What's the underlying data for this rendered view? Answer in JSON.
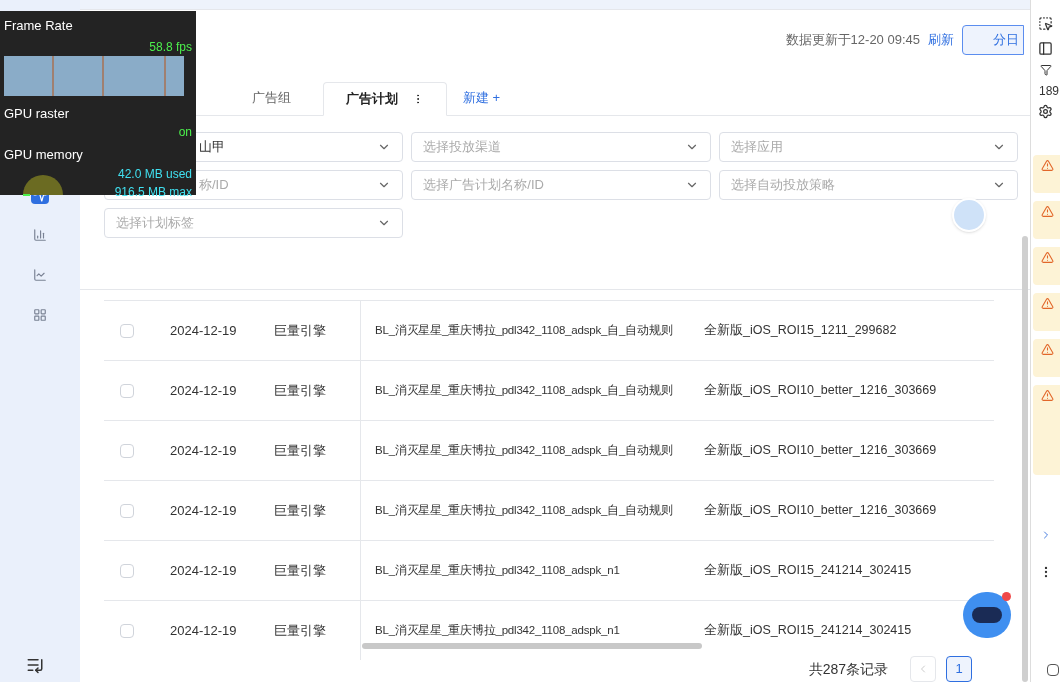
{
  "overlay": {
    "frame_rate_label": "Frame Rate",
    "fps": "58.8 fps",
    "gpu_raster_label": "GPU raster",
    "gpu_raster_value": "on",
    "gpu_memory_label": "GPU memory",
    "memory_used": "42.0 MB used",
    "memory_max": "916.5 MB max"
  },
  "sidebar": {
    "items": [
      {
        "selected": true
      },
      {
        "selected": false
      },
      {
        "selected": false
      },
      {
        "selected": false
      }
    ]
  },
  "header": {
    "updated": "数据更新于12-20 09:45",
    "refresh": "刷新",
    "granularity": "分日"
  },
  "tabs": [
    {
      "label": "广告组",
      "selected": false
    },
    {
      "label": "广告计划",
      "selected": true
    }
  ],
  "new_tab": "新建 +",
  "filters": [
    {
      "value": "山甲",
      "covered": true
    },
    {
      "placeholder": "选择投放渠道"
    },
    {
      "placeholder": "选择应用"
    },
    {
      "placeholder": "称/ID",
      "covered": true
    },
    {
      "placeholder": "选择广告计划名称/ID"
    },
    {
      "placeholder": "选择自动投放策略"
    },
    {
      "placeholder": "选择计划标签"
    }
  ],
  "table": {
    "rows": [
      {
        "checked": false,
        "date": "2024-12-19",
        "channel": "巨量引擎",
        "campaign": "BL_消灭星星_重庆博拉_pdl342_1108_adspk_自_自动规则",
        "plan": "全新版_iOS_ROI15_1211_299682"
      },
      {
        "checked": false,
        "date": "2024-12-19",
        "channel": "巨量引擎",
        "campaign": "BL_消灭星星_重庆博拉_pdl342_1108_adspk_自_自动规则",
        "plan": "全新版_iOS_ROI10_better_1216_303669"
      },
      {
        "checked": false,
        "date": "2024-12-19",
        "channel": "巨量引擎",
        "campaign": "BL_消灭星星_重庆博拉_pdl342_1108_adspk_自_自动规则",
        "plan": "全新版_iOS_ROI10_better_1216_303669"
      },
      {
        "checked": false,
        "date": "2024-12-19",
        "channel": "巨量引擎",
        "campaign": "BL_消灭星星_重庆博拉_pdl342_1108_adspk_自_自动规则",
        "plan": "全新版_iOS_ROI10_better_1216_303669"
      },
      {
        "checked": false,
        "date": "2024-12-19",
        "channel": "巨量引擎",
        "campaign": "BL_消灭星星_重庆博拉_pdl342_1108_adspk_n1",
        "plan": "全新版_iOS_ROI15_241214_302415"
      },
      {
        "checked": false,
        "date": "2024-12-19",
        "channel": "巨量引擎",
        "campaign": "BL_消灭星星_重庆博拉_pdl342_1108_adspk_n1",
        "plan": "全新版_iOS_ROI15_241214_302415"
      }
    ]
  },
  "pagination": {
    "total": "共287条记录",
    "pages": [
      {
        "label": "1",
        "selected": true
      }
    ]
  },
  "devtools": {
    "count": "189",
    "warnings": [
      {
        "kind": "short"
      },
      {
        "kind": "short"
      },
      {
        "kind": "short"
      },
      {
        "kind": "short"
      },
      {
        "kind": "short"
      },
      {
        "kind": "tall"
      }
    ],
    "checkbox_checked": false
  }
}
